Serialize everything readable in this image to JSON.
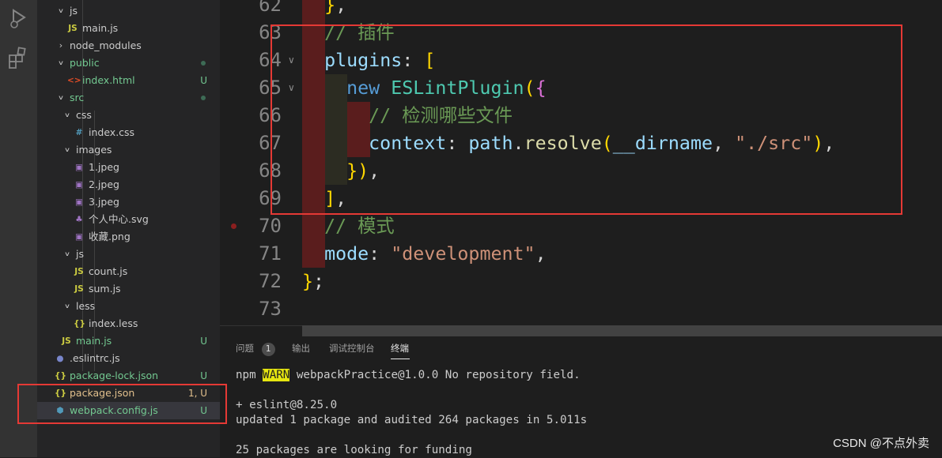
{
  "explorer": {
    "items": [
      {
        "label": "js",
        "kind": "folder",
        "expanded": true,
        "badge": "",
        "tone": "normal"
      },
      {
        "label": "main.js",
        "kind": "js",
        "badge": "",
        "tone": "normal"
      },
      {
        "label": "node_modules",
        "kind": "folder",
        "expanded": false,
        "badge": "",
        "tone": "normal"
      },
      {
        "label": "public",
        "kind": "folder",
        "expanded": true,
        "badge": "",
        "tone": "green"
      },
      {
        "label": "index.html",
        "kind": "html",
        "badge": "U",
        "tone": "green"
      },
      {
        "label": "src",
        "kind": "folder",
        "expanded": true,
        "badge": "",
        "tone": "green"
      },
      {
        "label": "css",
        "kind": "folder",
        "expanded": true,
        "badge": "",
        "tone": "normal"
      },
      {
        "label": "index.css",
        "kind": "css",
        "badge": "",
        "tone": "normal"
      },
      {
        "label": "images",
        "kind": "folder",
        "expanded": true,
        "badge": "",
        "tone": "normal"
      },
      {
        "label": "1.jpeg",
        "kind": "image",
        "badge": "",
        "tone": "normal"
      },
      {
        "label": "2.jpeg",
        "kind": "image",
        "badge": "",
        "tone": "normal"
      },
      {
        "label": "3.jpeg",
        "kind": "image",
        "badge": "",
        "tone": "normal"
      },
      {
        "label": "个人中心.svg",
        "kind": "svg",
        "badge": "",
        "tone": "normal"
      },
      {
        "label": "收藏.png",
        "kind": "image",
        "badge": "",
        "tone": "normal"
      },
      {
        "label": "js",
        "kind": "folder",
        "expanded": true,
        "badge": "",
        "tone": "normal"
      },
      {
        "label": "count.js",
        "kind": "js",
        "badge": "",
        "tone": "normal"
      },
      {
        "label": "sum.js",
        "kind": "js",
        "badge": "",
        "tone": "normal"
      },
      {
        "label": "less",
        "kind": "folder",
        "expanded": true,
        "badge": "",
        "tone": "normal"
      },
      {
        "label": "index.less",
        "kind": "json",
        "badge": "",
        "tone": "normal"
      },
      {
        "label": "main.js",
        "kind": "js",
        "badge": "U",
        "tone": "green"
      },
      {
        "label": ".eslintrc.js",
        "kind": "eslint",
        "badge": "",
        "tone": "normal"
      },
      {
        "label": "package-lock.json",
        "kind": "json",
        "badge": "U",
        "tone": "green"
      },
      {
        "label": "package.json",
        "kind": "json",
        "badge": "1, U",
        "tone": "yellow"
      },
      {
        "label": "webpack.config.js",
        "kind": "webpack",
        "badge": "U",
        "tone": "green"
      }
    ]
  },
  "editor": {
    "lines": [
      {
        "n": "62",
        "code": "  },"
      },
      {
        "n": "63",
        "code": "  // 插件"
      },
      {
        "n": "64",
        "code": "  plugins: ["
      },
      {
        "n": "65",
        "code": "    new ESLintPlugin({"
      },
      {
        "n": "66",
        "code": "      // 检测哪些文件"
      },
      {
        "n": "67",
        "code": "      context: path.resolve(__dirname, \"./src\"),"
      },
      {
        "n": "68",
        "code": "    }),"
      },
      {
        "n": "69",
        "code": "  ],"
      },
      {
        "n": "70",
        "code": "  // 模式"
      },
      {
        "n": "71",
        "code": "  mode: \"development\","
      },
      {
        "n": "72",
        "code": "};"
      },
      {
        "n": "73",
        "code": ""
      }
    ]
  },
  "panel": {
    "tabs": [
      {
        "label": "问题",
        "count": "1"
      },
      {
        "label": "输出"
      },
      {
        "label": "调试控制台"
      },
      {
        "label": "终端"
      }
    ],
    "active_tab": "终端",
    "terminal": {
      "line1_prefix": "npm ",
      "line1_warn": "WARN",
      "line1_rest": " webpackPractice@1.0.0 No repository field.",
      "line2": "+ eslint@8.25.0",
      "line3": "updated 1 package and audited 264 packages in 5.011s",
      "line4": "25 packages are looking for funding"
    }
  },
  "watermark": "CSDN @不点外卖",
  "colors": {
    "accent_green": "#73c991",
    "accent_yellow": "#e2c08d",
    "highlight_red": "#e53935"
  }
}
